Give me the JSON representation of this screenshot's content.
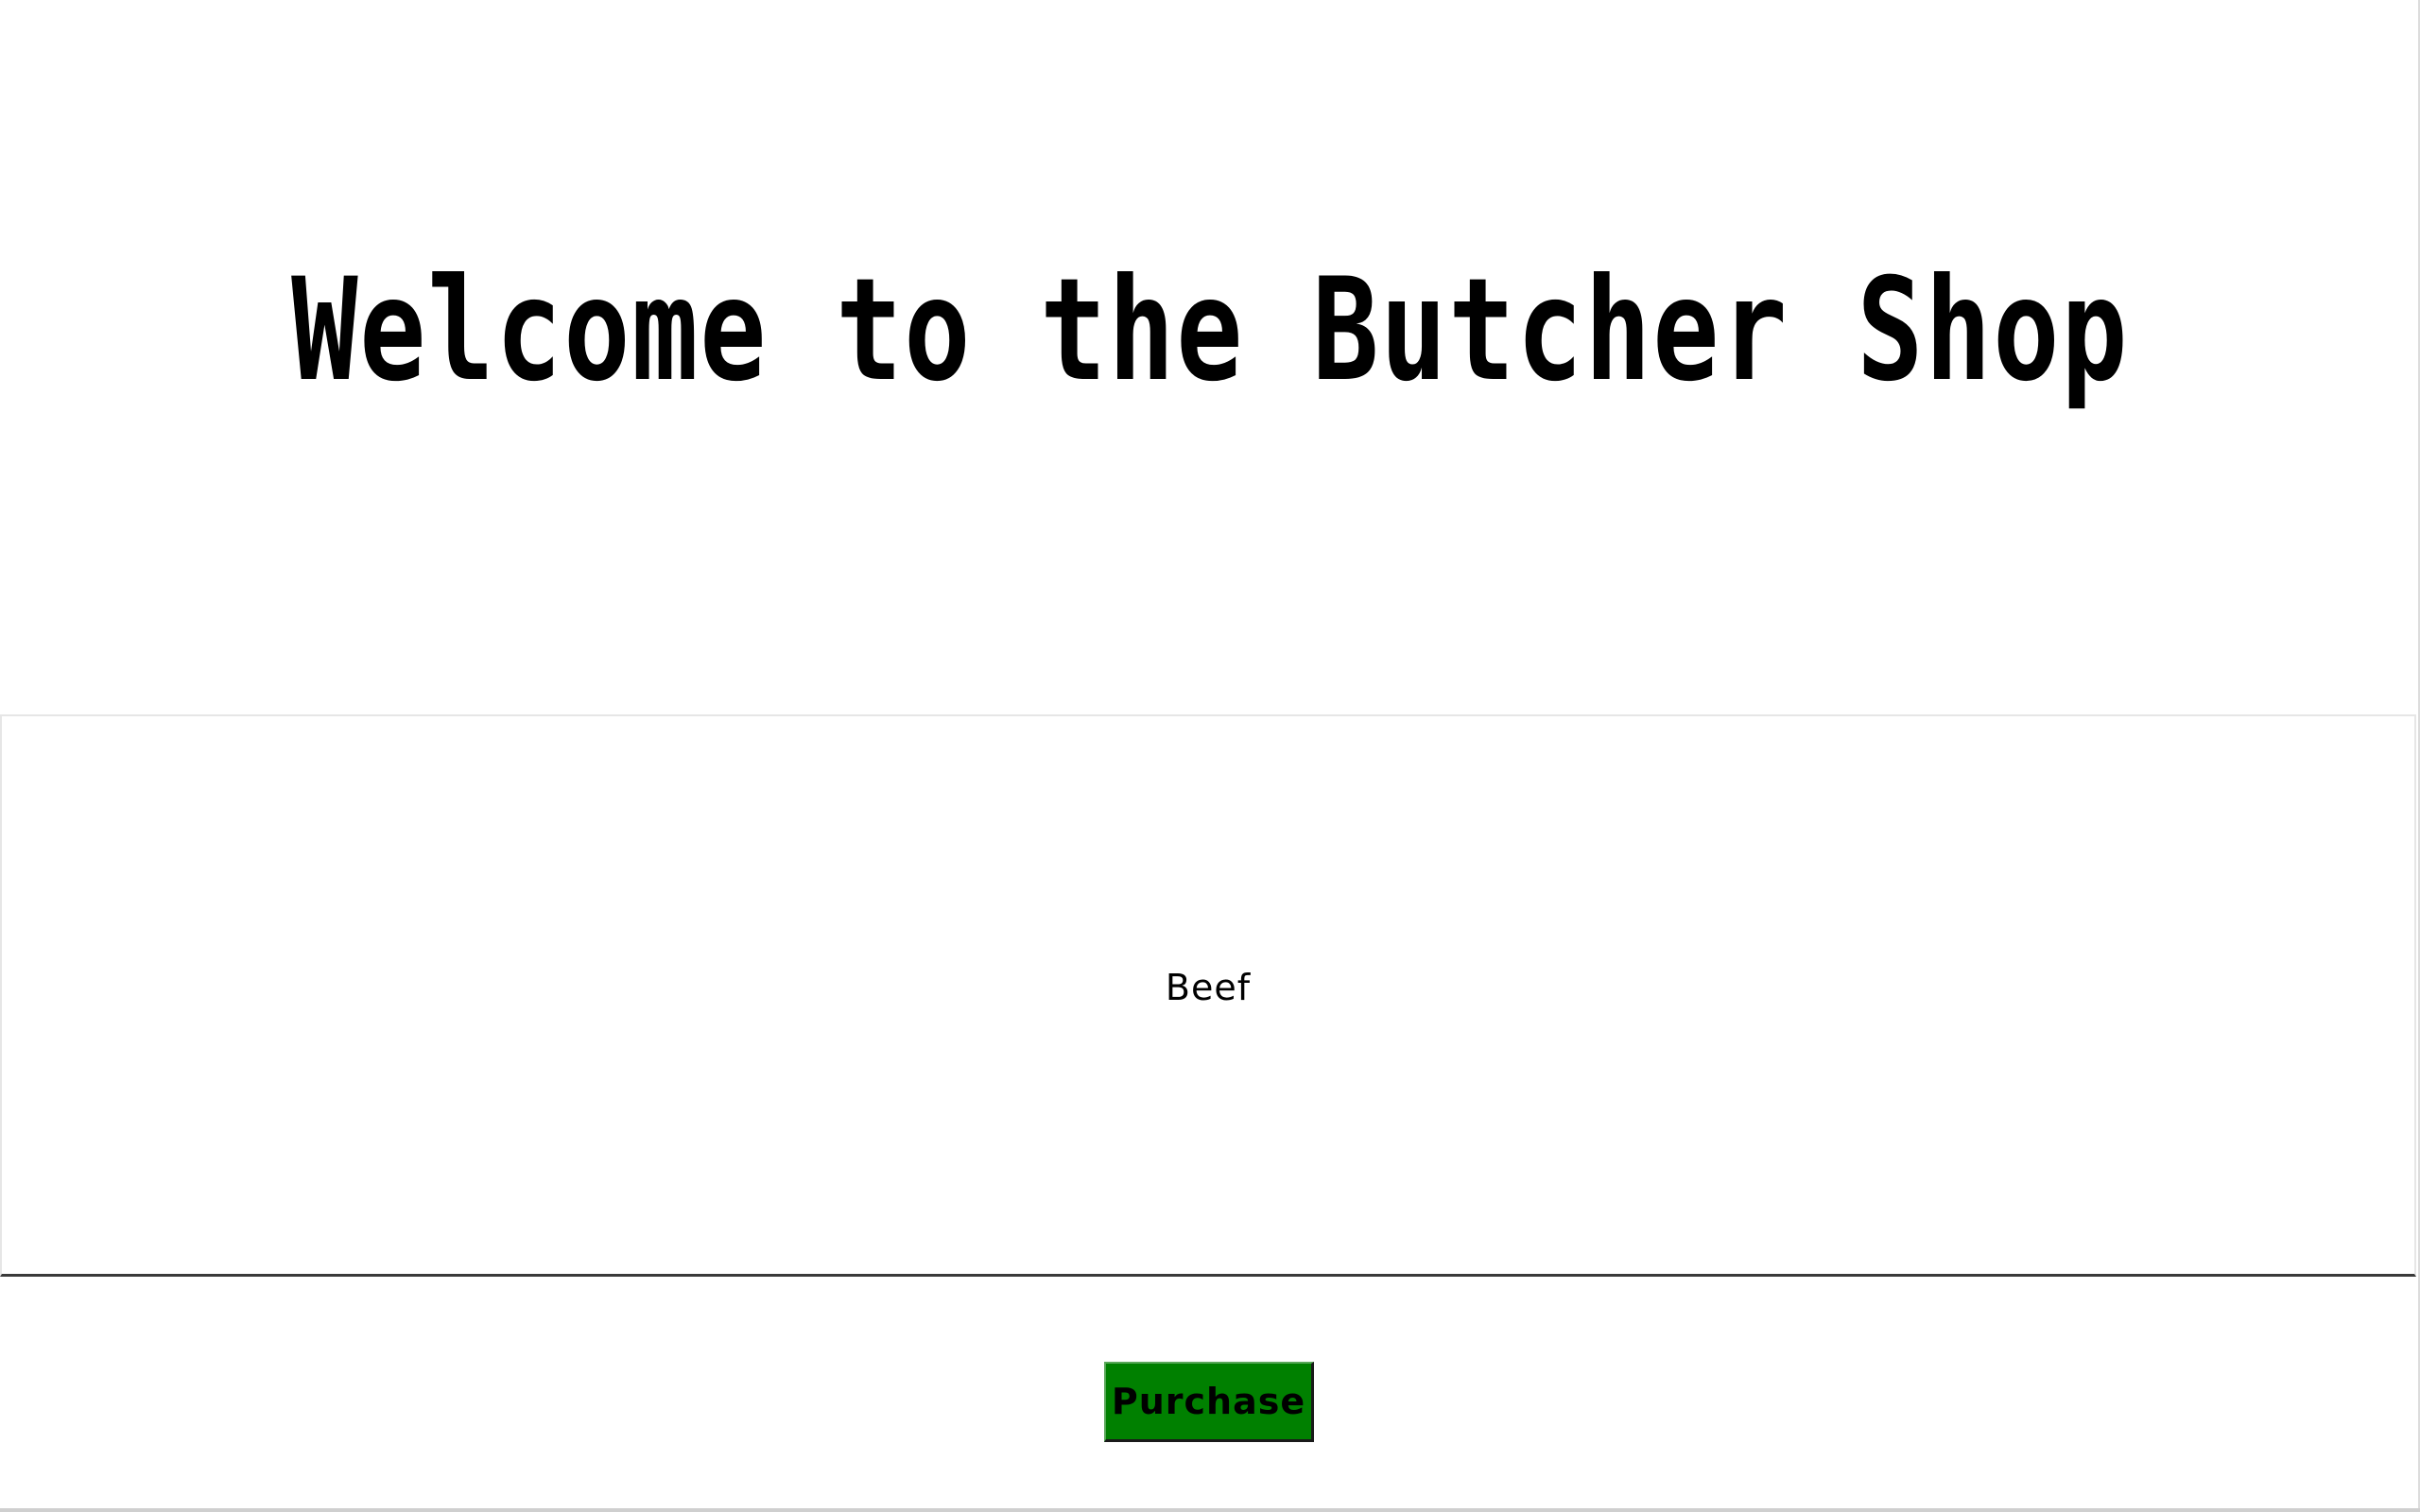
{
  "header": {
    "title": "Welcome to the Butcher Shop"
  },
  "product": {
    "name": "Beef"
  },
  "actions": {
    "purchase_label": "Purchase"
  },
  "colors": {
    "background": "#ffffff",
    "purchase_button": "#008000",
    "text": "#000000"
  }
}
